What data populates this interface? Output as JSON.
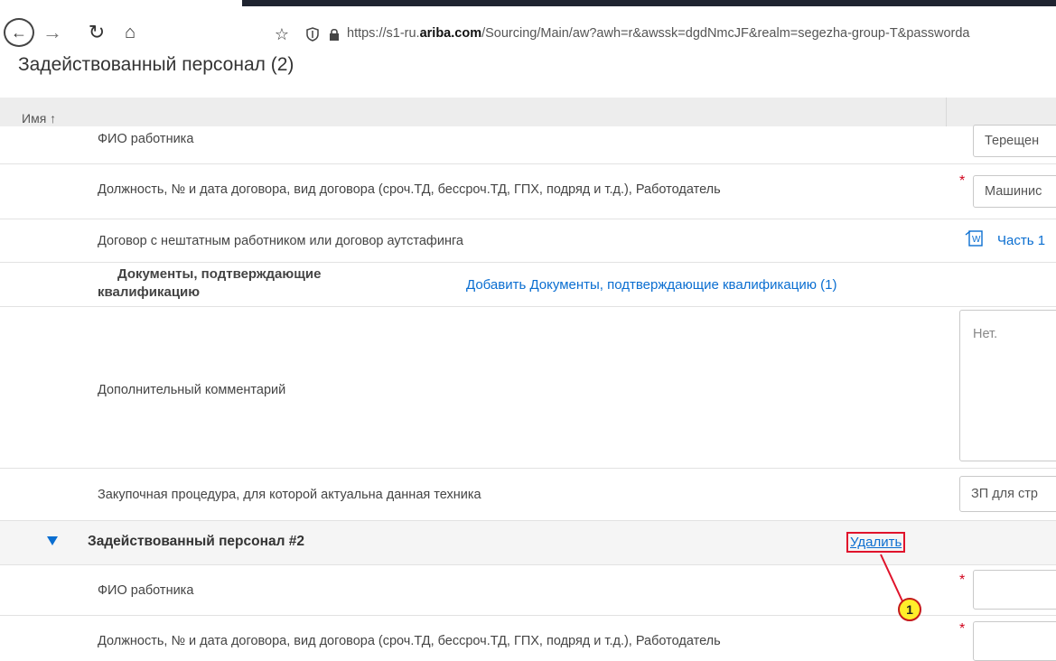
{
  "browser": {
    "url_prefix": "https://s1-ru.",
    "url_domain": "ariba.com",
    "url_rest": "/Sourcing/Main/aw?awh=r&awssk=dgdNmcJF&realm=segezha-group-T&passworda"
  },
  "section": {
    "title": "Задействованный персонал (2)"
  },
  "table": {
    "name_header": "Имя ↑"
  },
  "rows": {
    "fio_1": {
      "label": "ФИО работника",
      "value": "Терещен"
    },
    "position_1": {
      "label": "Должность, № и дата договора, вид договора (сроч.ТД, бессроч.ТД, ГПХ, подряд и т.д.), Работодатель",
      "value": "Машинис"
    },
    "contract": {
      "label": "Договор с нештатным работником или договор аутстафинга",
      "link": "Часть 1"
    },
    "docs": {
      "label_line1": "Документы, подтверждающие",
      "label_line2": "квалификацию",
      "link": "Добавить Документы, подтверждающие квалификацию (1)"
    },
    "comment": {
      "label": "Дополнительный комментарий",
      "value": "Нет."
    },
    "procurement": {
      "label": "Закупочная процедура, для которой актуальна данная техника",
      "value": "ЗП для стр"
    },
    "fio_2": {
      "label": "ФИО работника"
    },
    "position_2": {
      "label": "Должность, № и дата договора, вид договора (сроч.ТД, бессроч.ТД, ГПХ, подряд и т.д.), Работодатель"
    }
  },
  "group": {
    "title": "Задействованный персонал #2",
    "delete_label": "Удалить"
  },
  "callout": {
    "number": "1"
  },
  "colors": {
    "link": "#0a6ed1",
    "required": "#d0021b",
    "callout_border": "#e0132b",
    "callout_fill": "#ffee2a"
  }
}
